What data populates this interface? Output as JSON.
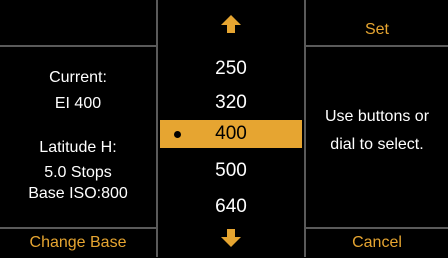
{
  "softkeys": {
    "top_left": "",
    "top_right": "Set",
    "bottom_left": "Change Base",
    "bottom_right": "Cancel"
  },
  "current": {
    "label": "Current:",
    "value": "EI 400"
  },
  "latitude": {
    "label": "Latitude H:",
    "value": "5.0 Stops",
    "base_iso": "Base ISO:800"
  },
  "picker": {
    "items": [
      "250",
      "320",
      "400",
      "500",
      "640"
    ],
    "selected_index": 2,
    "up_icon": "arrow-up-icon",
    "down_icon": "arrow-down-icon"
  },
  "hint": {
    "line1": "Use buttons or",
    "line2": "dial to select."
  },
  "colors": {
    "accent": "#e6a531",
    "background": "#000000",
    "divider": "#5a5a5a",
    "text": "#ffffff"
  }
}
